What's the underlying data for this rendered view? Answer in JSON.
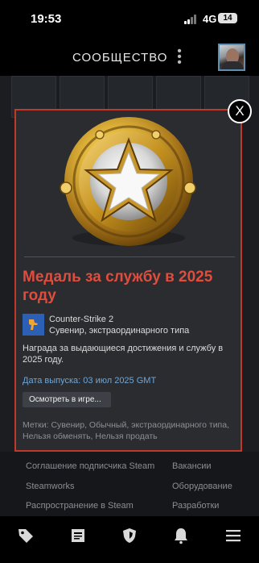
{
  "status_bar": {
    "time": "19:53",
    "network": "4G",
    "battery": "14"
  },
  "header": {
    "title": "СООБЩЕСТВО",
    "menu_icon": "more-vertical-icon",
    "avatar_icon": "user-avatar"
  },
  "background_page": {
    "footer_links": [
      "Соглашение подписчика Steam",
      "Вакансии",
      "Steamworks",
      "Оборудование",
      "Распространение в Steam",
      "Разработки"
    ]
  },
  "modal": {
    "close_label": "X",
    "title": "Медаль за службу в 2025 году",
    "game_name": "Counter-Strike 2",
    "item_type": "Сувенир, экстраординарного типа",
    "description": "Награда за выдающиеся достижения и службу в 2025 году.",
    "release_date": "Дата выпуска: 03 июл 2025 GMT",
    "inspect_button": "Осмотреть в игре...",
    "tags": "Метки: Сувенир, Обычный, экстраординарного типа, Нельзя обменять, Нельзя продать",
    "accent_color": "#c0392b",
    "title_color": "#e14c3c"
  },
  "bottom_nav": {
    "items": [
      "tag-icon",
      "news-icon",
      "shield-icon",
      "bell-icon",
      "menu-icon"
    ]
  }
}
